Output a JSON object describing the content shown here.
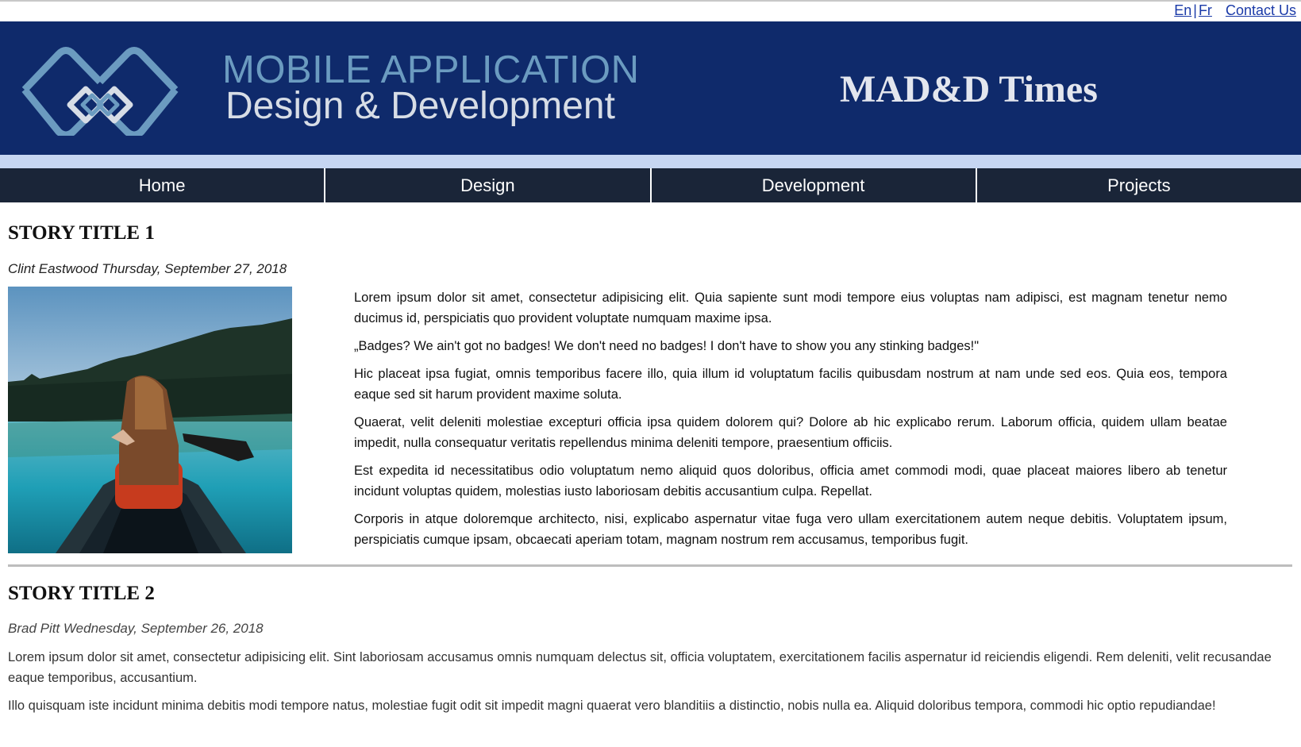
{
  "top_links": {
    "en": "En",
    "sep": "|",
    "fr": "Fr",
    "contact": "Contact Us"
  },
  "header": {
    "logo_line1": "MOBILE APPLICATION",
    "logo_line2": "Design & Development",
    "site_title": "MAD&D Times",
    "logo_icon": "interlocking-diamonds-icon"
  },
  "nav": {
    "home": "Home",
    "design": "Design",
    "development": "Development",
    "projects": "Projects"
  },
  "story1": {
    "title": "STORY TITLE 1",
    "byline": "Clint Eastwood Thursday, September 27, 2018",
    "paragraphs": [
      "Lorem ipsum dolor sit amet, consectetur adipisicing elit. Quia sapiente sunt modi tempore eius voluptas nam adipisci, est magnam tenetur nemo ducimus id, perspiciatis quo provident voluptate numquam maxime ipsa.",
      "„Badges? We ain't got no badges! We don't need no badges! I don't have to show you any stinking badges!\"",
      "Hic placeat ipsa fugiat, omnis temporibus facere illo, quia illum id voluptatum facilis quibusdam nostrum at nam unde sed eos. Quia eos, tempora eaque sed sit harum provident maxime soluta.",
      "Quaerat, velit deleniti molestiae excepturi officia ipsa quidem dolorem qui? Dolore ab hic explicabo rerum. Laborum officia, quidem ullam beatae impedit, nulla consequatur veritatis repellendus minima deleniti tempore, praesentium officiis.",
      "Est expedita id necessitatibus odio voluptatum nemo aliquid quos doloribus, officia amet commodi modi, quae placeat maiores libero ab tenetur incidunt voluptas quidem, molestias iusto laboriosam debitis accusantium culpa. Repellat.",
      "Corporis in atque doloremque architecto, nisi, explicabo aspernatur vitae fuga vero ullam exercitationem autem neque debitis. Voluptatem ipsum, perspiciatis cumque ipsam, obcaecati aperiam totam, magnam nostrum rem accusamus, temporibus fugit."
    ]
  },
  "story2": {
    "title": "STORY TITLE 2",
    "byline": "Brad Pitt Wednesday, September 26, 2018",
    "paragraphs": [
      "Lorem ipsum dolor sit amet, consectetur adipisicing elit. Sint laboriosam accusamus omnis numquam delectus sit, officia voluptatem, exercitationem facilis aspernatur id reiciendis eligendi. Rem deleniti, velit recusandae eaque temporibus, accusantium.",
      "Illo quisquam iste incidunt minima debitis modi tempore natus, molestiae fugit odit sit impedit magni quaerat vero blanditiis a distinctio, nobis nulla ea. Aliquid doloribus tempora, commodi hic optio repudiandae!"
    ]
  },
  "colors": {
    "banner": "#0f2a6b",
    "banner_stripe": "#c6d6f2",
    "nav_bg": "#1a2538",
    "link": "#1a3aa8",
    "logo_accent": "#6b9bc0"
  }
}
